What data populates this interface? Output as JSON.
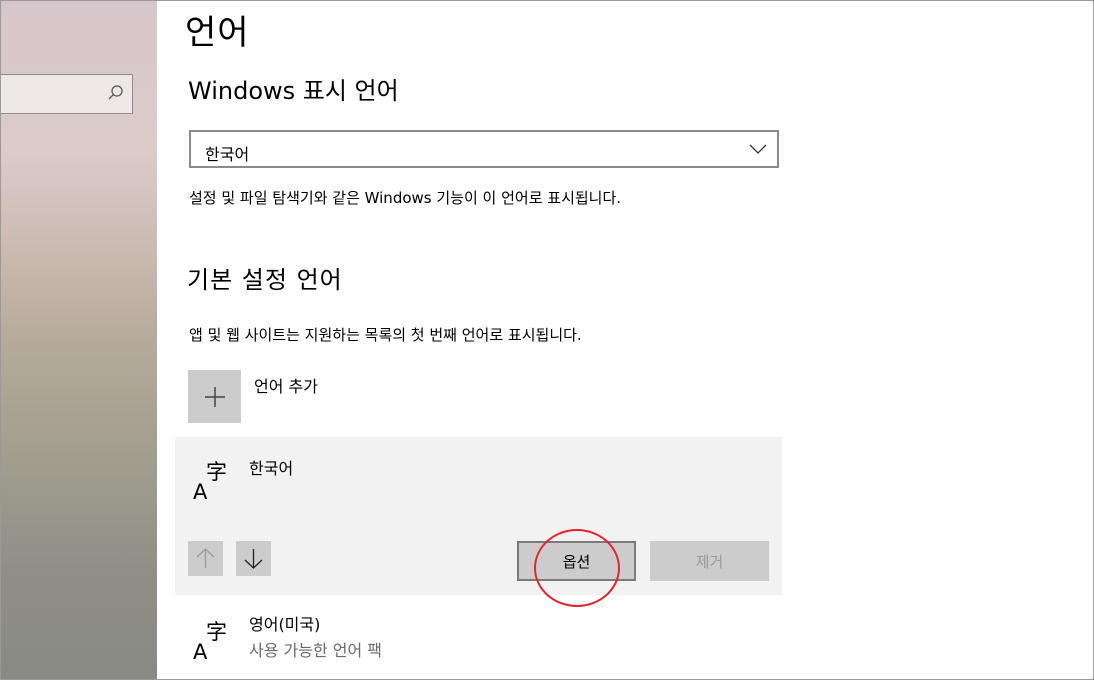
{
  "sidebar": {
    "search": {
      "placeholder": "",
      "icon": "search-icon"
    }
  },
  "page": {
    "title": "언어",
    "display_language": {
      "heading": "Windows 표시 언어",
      "selected": "한국어",
      "description": "설정 및 파일 탐색기와 같은 Windows 기능이 이 언어로 표시됩니다."
    },
    "preferred": {
      "heading": "기본 설정 언어",
      "description": "앱 및 웹 사이트는 지원하는 목록의 첫 번째 언어로 표시됩니다.",
      "add_label": "언어 추가",
      "languages": [
        {
          "name": "한국어",
          "subtitle": "",
          "icon": "language-icon"
        },
        {
          "name": "영어(미국)",
          "subtitle": "사용 가능한 언어 팩",
          "icon": "language-icon"
        }
      ],
      "options_label": "옵션",
      "remove_label": "제거"
    }
  },
  "colors": {
    "annotation_circle": "#e3262a",
    "tile": "#cccccc",
    "panel": "#f2f2f2"
  }
}
